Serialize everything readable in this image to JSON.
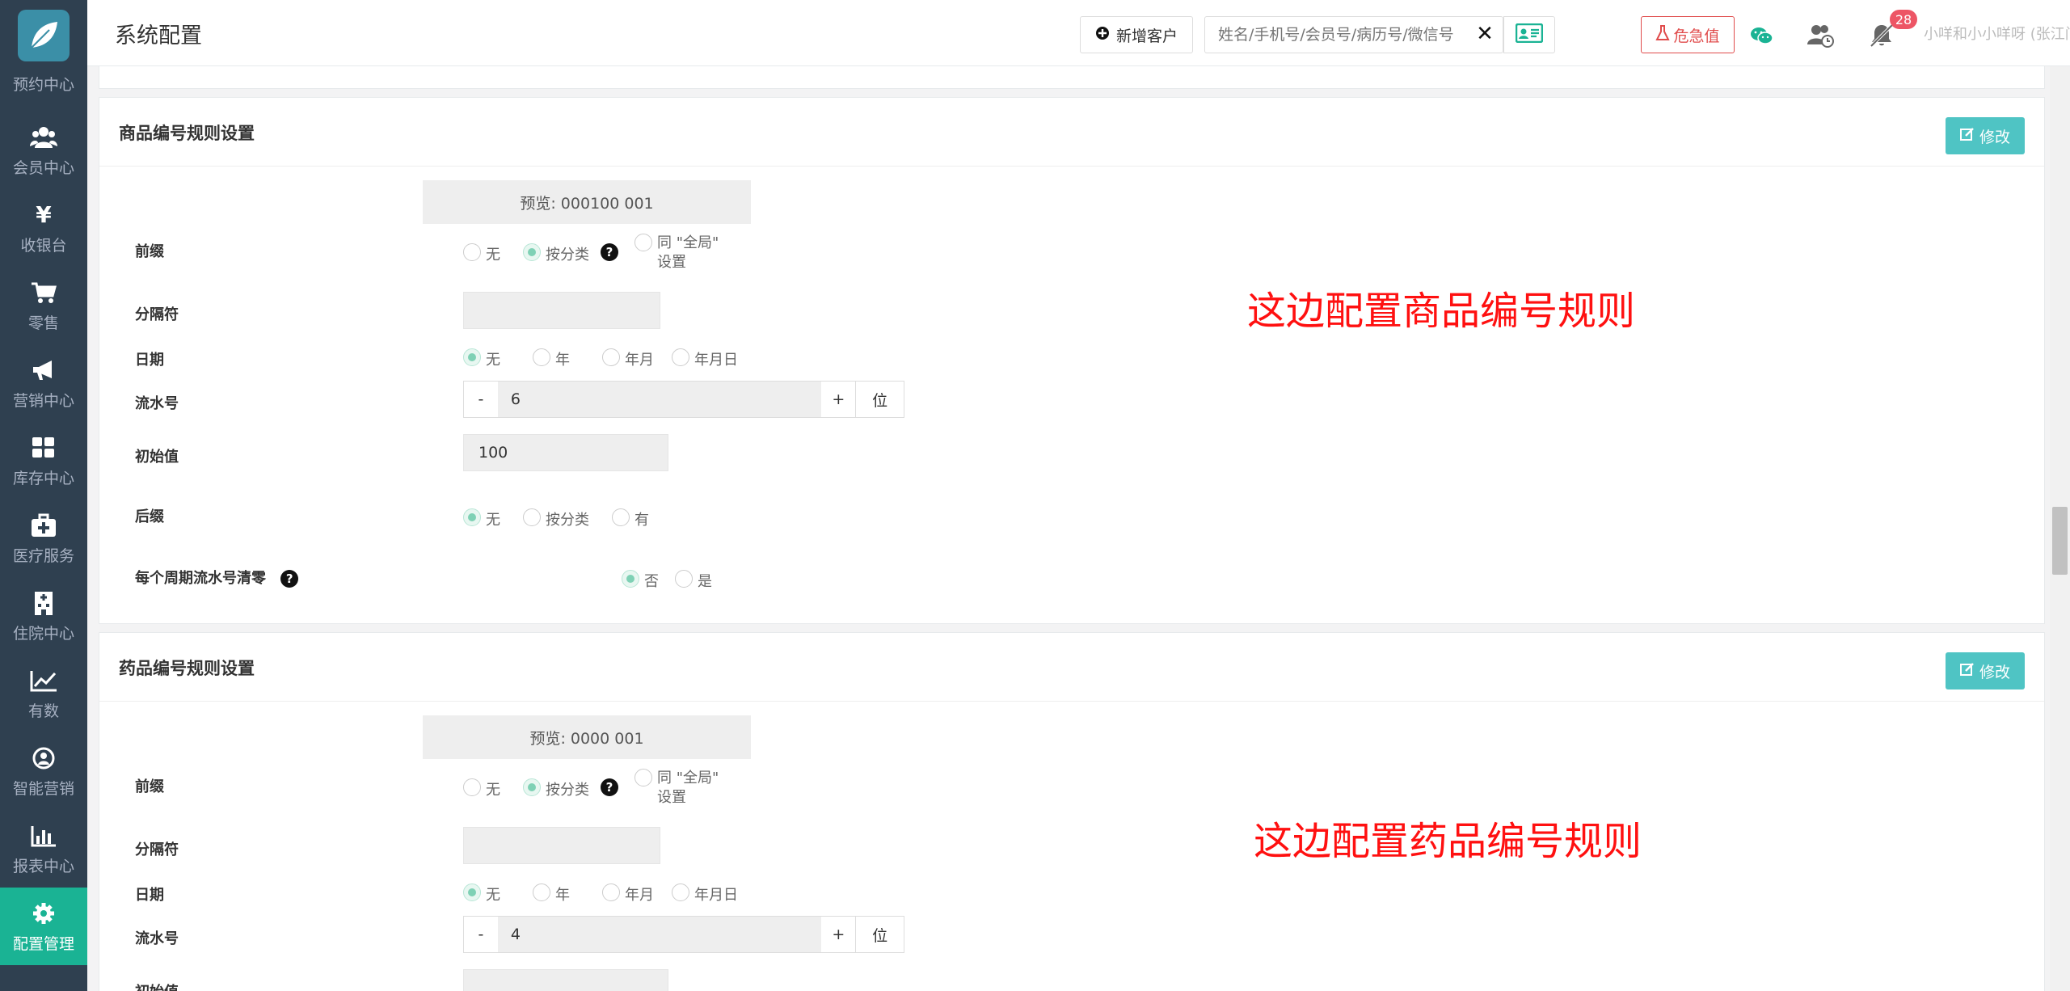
{
  "app": {
    "title": "系统配置"
  },
  "sidebar": {
    "items": [
      {
        "label": "预约中心",
        "icon": "calendar-icon",
        "active": false
      },
      {
        "label": "会员中心",
        "icon": "users-icon",
        "active": false
      },
      {
        "label": "收银台",
        "icon": "yen-icon",
        "active": false
      },
      {
        "label": "零售",
        "icon": "cart-icon",
        "active": false
      },
      {
        "label": "营销中心",
        "icon": "megaphone-icon",
        "active": false
      },
      {
        "label": "库存中心",
        "icon": "grid-icon",
        "active": false
      },
      {
        "label": "医疗服务",
        "icon": "medkit-icon",
        "active": false
      },
      {
        "label": "住院中心",
        "icon": "hospital-icon",
        "active": false
      },
      {
        "label": "有数",
        "icon": "line-chart-icon",
        "active": false
      },
      {
        "label": "智能营销",
        "icon": "support-icon",
        "active": false
      },
      {
        "label": "报表中心",
        "icon": "bar-chart-icon",
        "active": false
      },
      {
        "label": "配置管理",
        "icon": "gear-icon",
        "active": true
      }
    ]
  },
  "header": {
    "add_customer_label": "新增客户",
    "search_placeholder": "姓名/手机号/会员号/病历号/微信号",
    "clear_symbol": "✕",
    "critical_label": "危急值",
    "notification_count": "28",
    "user_name": "小咩和小小咩呀 (张江门诊部)",
    "colors": {
      "accent": "#1ab394",
      "danger": "#e04b4b",
      "edit": "#4fc4c4",
      "annotation": "#ff1010"
    }
  },
  "panels": {
    "goods": {
      "title": "商品编号规则设置",
      "edit_label": "修改",
      "preview": "预览:   000100 001",
      "prefix_label": "前缀",
      "prefix_opts": [
        "无",
        "按分类",
        "同 \"全局\"",
        "设置"
      ],
      "help_symbol": "?",
      "separator_label": "分隔符",
      "date_label": "日期",
      "date_opts": [
        "无",
        "年",
        "年月",
        "年月日"
      ],
      "serial_label": "流水号",
      "serial_minus": "-",
      "serial_value": "6",
      "serial_plus": "+",
      "serial_unit": "位",
      "initial_label": "初始值",
      "initial_value": "100",
      "suffix_label": "后缀",
      "suffix_opts": [
        "无",
        "按分类",
        "有"
      ],
      "reset_label": "每个周期流水号清零",
      "reset_opts": [
        "否",
        "是"
      ],
      "annotation": "这边配置商品编号规则"
    },
    "drug": {
      "title": "药品编号规则设置",
      "edit_label": "修改",
      "preview": "预览:   0000 001",
      "prefix_label": "前缀",
      "prefix_opts": [
        "无",
        "按分类",
        "同 \"全局\"",
        "设置"
      ],
      "help_symbol": "?",
      "separator_label": "分隔符",
      "date_label": "日期",
      "date_opts": [
        "无",
        "年",
        "年月",
        "年月日"
      ],
      "serial_label": "流水号",
      "serial_minus": "-",
      "serial_value": "4",
      "serial_plus": "+",
      "serial_unit": "位",
      "initial_label": "初始值",
      "annotation": "这边配置药品编号规则"
    }
  }
}
